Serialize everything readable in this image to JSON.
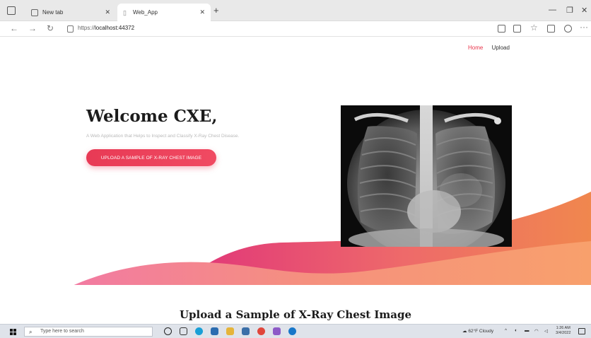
{
  "browser": {
    "tabs": [
      {
        "label": "New tab",
        "active": false
      },
      {
        "label": "Web_App",
        "active": true
      }
    ],
    "url_prefix": "https://",
    "url_host": "localhost:44372"
  },
  "site": {
    "nav": [
      {
        "label": "Home",
        "active": true
      },
      {
        "label": "Upload",
        "active": false
      }
    ],
    "hero": {
      "title": "Welcome CXE,",
      "subtitle": "A Web Application that Helps to Inspect and Classify X-Ray Chest Disease.",
      "cta_label": "UPLOAD A SAMPLE OF X-RAY CHEST IMAGE"
    },
    "section_title": "Upload a Sample of X-Ray Chest Image"
  },
  "taskbar": {
    "search_placeholder": "Type here to search",
    "weather": "62°F Cloudy",
    "time": "1:26 AM",
    "date": "3/4/2022"
  },
  "colors": {
    "accent": "#e83a55",
    "wave_pink": "#e84a7e",
    "wave_orange": "#f5a36c"
  }
}
